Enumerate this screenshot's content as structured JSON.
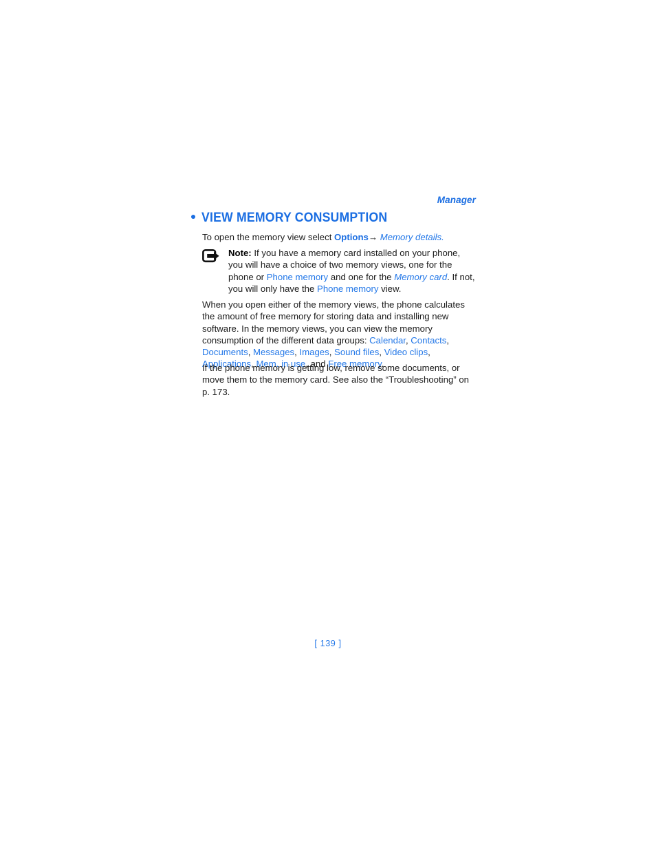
{
  "page": {
    "background_color": "#ffffff",
    "accent_color": "#1b6ee2",
    "link_color": "#2277e8",
    "text_color": "#1b1b1b",
    "folio": "[ 139 ]"
  },
  "running_header": {
    "text": "Manager"
  },
  "heading": {
    "bullet": "bullet-dot",
    "text": "VIEW MEMORY CONSUMPTION"
  },
  "lead_line": {
    "part_1": "To open the memory view select ",
    "options_label": "Options",
    "arrow": "→",
    "space": " ",
    "memory_details_label": "Memory details."
  },
  "note": {
    "icon": "note-arrow-icon",
    "label": "Note:",
    "part_1": " If you have a memory card installed on your phone, you will have a choice of two memory views, one for the phone or ",
    "link_phone_memory_1": "Phone memory",
    "part_2": " and one for the ",
    "link_memory_card": "Memory card",
    "part_3": ". If not, you will only have the ",
    "link_phone_memory_2": "Phone memory",
    "part_4": " view."
  },
  "paragraph_1": {
    "part_1": "When you open either of the memory views, the phone calculates the amount of free memory for storing data and installing new software. In the memory views, you can view the memory consumption of the different data groups: ",
    "items": [
      "Calendar",
      "Contacts",
      "Documents",
      "Messages",
      "Images",
      "Sound files",
      "Video clips",
      "Applications",
      "Mem. in use",
      "Free memory"
    ],
    "separator": ", ",
    "conjunction": ", and ",
    "terminator": "."
  },
  "paragraph_2": {
    "text": "If the phone memory is getting low, remove some documents, or move them to the memory card. See also the “Troubleshooting” on p. 173."
  }
}
